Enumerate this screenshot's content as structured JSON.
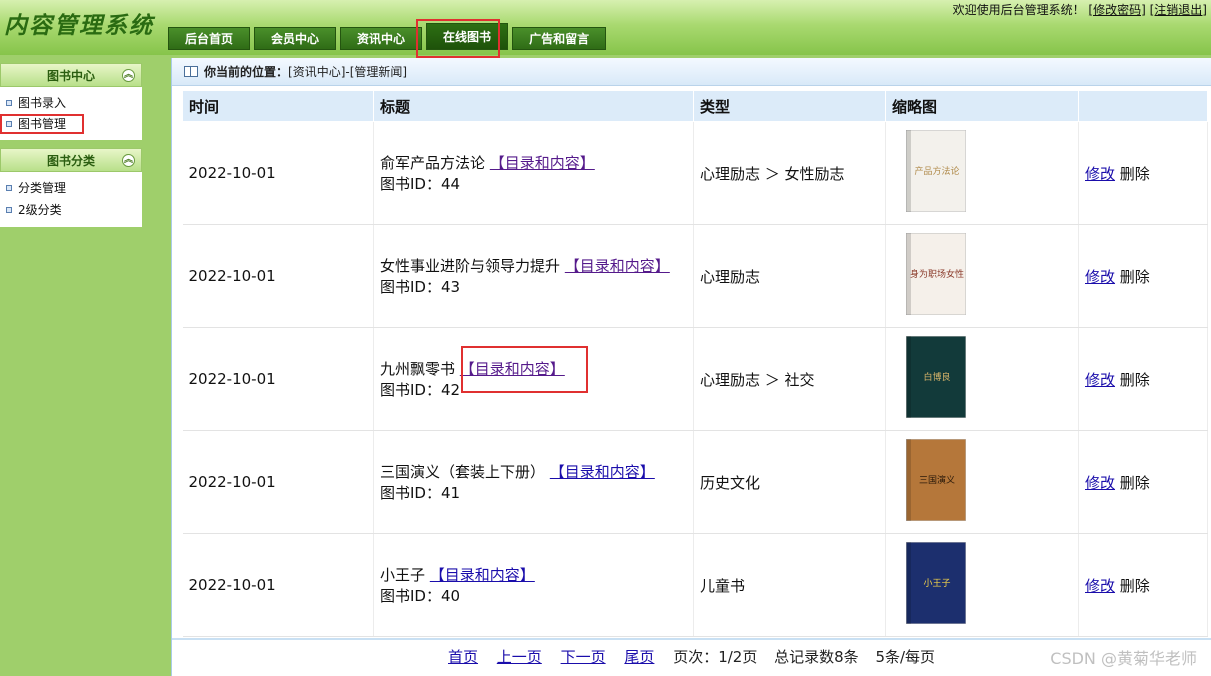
{
  "app": {
    "logo": "内容管理系统",
    "welcome_text": "欢迎使用后台管理系统！",
    "change_password": "[修改密码]",
    "logout": "[注销退出]"
  },
  "nav": {
    "tabs": [
      "后台首页",
      "会员中心",
      "资讯中心",
      "在线图书",
      "广告和留言"
    ],
    "active_index": 3
  },
  "sidebar": {
    "section1": {
      "title": "图书中心",
      "items": [
        "图书录入",
        "图书管理"
      ],
      "selected_index": 1
    },
    "section2": {
      "title": "图书分类",
      "items": [
        "分类管理",
        "2级分类"
      ]
    }
  },
  "breadcrumb": {
    "label": "你当前的位置：",
    "path": "[资讯中心]-[管理新闻]"
  },
  "table": {
    "headers": [
      "时间",
      "标题",
      "类型",
      "缩略图",
      ""
    ],
    "link_text": "【目录和内容】",
    "id_label": "图书ID：",
    "edit_label": "修改",
    "delete_label": "删除",
    "rows": [
      {
        "time": "2022-10-01",
        "title": "俞军产品方法论",
        "id": "44",
        "type": "心理励志 ＞ 女性励志",
        "cover_text": "产品方法论"
      },
      {
        "time": "2022-10-01",
        "title": "女性事业进阶与领导力提升",
        "id": "43",
        "type": "心理励志",
        "cover_text": "身为职场女性"
      },
      {
        "time": "2022-10-01",
        "title": "九州飘零书",
        "id": "42",
        "type": "心理励志 ＞ 社交",
        "cover_text": "白博良"
      },
      {
        "time": "2022-10-01",
        "title": "三国演义（套装上下册）",
        "id": "41",
        "type": "历史文化",
        "cover_text": "三国演义"
      },
      {
        "time": "2022-10-01",
        "title": "小王子",
        "id": "40",
        "type": "儿童书",
        "cover_text": "小王子"
      }
    ]
  },
  "pager": {
    "first": "首页",
    "prev": "上一页",
    "next": "下一页",
    "last": "尾页",
    "page_info": "页次：1/2页",
    "total_info": "总记录数8条",
    "per_page": "5条/每页"
  },
  "watermark": "CSDN @黄菊华老师"
}
